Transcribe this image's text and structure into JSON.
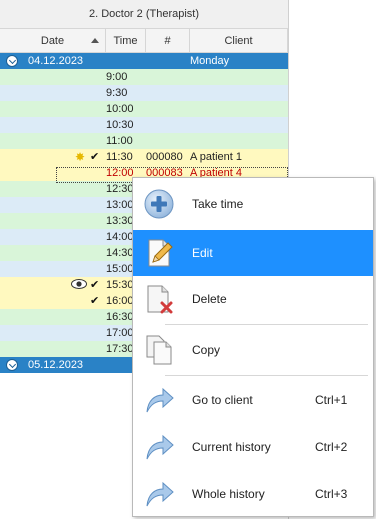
{
  "grid": {
    "doctor_header": "2. Doctor 2 (Therapist)",
    "columns": {
      "date": "Date",
      "time": "Time",
      "number": "#",
      "client": "Client"
    },
    "group1": {
      "date": "04.12.2023",
      "day": "Monday"
    },
    "group2": {
      "date": "05.12.2023"
    },
    "rows": [
      {
        "time": "9:00",
        "number": "",
        "client": ""
      },
      {
        "time": "9:30",
        "number": "",
        "client": ""
      },
      {
        "time": "10:00",
        "number": "",
        "client": ""
      },
      {
        "time": "10:30",
        "number": "",
        "client": ""
      },
      {
        "time": "11:00",
        "number": "",
        "client": ""
      },
      {
        "time": "11:30",
        "number": "000080",
        "client": "A patient 1"
      },
      {
        "time": "12:00",
        "number": "000083",
        "client": "A patient 4"
      },
      {
        "time": "12:30",
        "number": "",
        "client": ""
      },
      {
        "time": "13:00",
        "number": "",
        "client": ""
      },
      {
        "time": "13:30",
        "number": "",
        "client": ""
      },
      {
        "time": "14:00",
        "number": "",
        "client": ""
      },
      {
        "time": "14:30",
        "number": "",
        "client": ""
      },
      {
        "time": "15:00",
        "number": "",
        "client": ""
      },
      {
        "time": "15:30",
        "number": "",
        "client": ""
      },
      {
        "time": "16:00",
        "number": "",
        "client": ""
      },
      {
        "time": "16:30",
        "number": "",
        "client": ""
      },
      {
        "time": "17:00",
        "number": "",
        "client": ""
      },
      {
        "time": "17:30",
        "number": "",
        "client": ""
      }
    ]
  },
  "context_menu": {
    "items": [
      {
        "label": "Take time",
        "shortcut": "",
        "icon": "plus-circle-icon"
      },
      {
        "label": "Edit",
        "shortcut": "",
        "icon": "pencil-icon"
      },
      {
        "label": "Delete",
        "shortcut": "",
        "icon": "delete-doc-icon"
      },
      {
        "label": "Copy",
        "shortcut": "",
        "icon": "copy-icon"
      },
      {
        "label": "Go to client",
        "shortcut": "Ctrl+1",
        "icon": "arrow-icon"
      },
      {
        "label": "Current history",
        "shortcut": "Ctrl+2",
        "icon": "arrow-icon"
      },
      {
        "label": "Whole history",
        "shortcut": "Ctrl+3",
        "icon": "arrow-icon"
      }
    ]
  },
  "colors": {
    "group_header": "#2a82c6",
    "row_green": "#d9f5d9",
    "row_blue": "#dcebf7",
    "row_yellow": "#fff9bf",
    "menu_selected": "#1e90ff",
    "busy_text": "#c00000"
  }
}
